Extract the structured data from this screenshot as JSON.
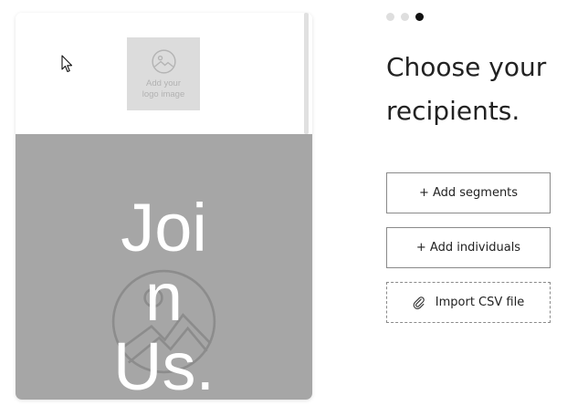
{
  "preview": {
    "logo_placeholder_line1": "Add your",
    "logo_placeholder_line2": "logo image",
    "hero_line1": "Joi",
    "hero_line2": "n",
    "hero_line3": "Us.",
    "background_color": "#a6a6a6"
  },
  "steps": {
    "total": 3,
    "current": 3
  },
  "title": {
    "line1": "Choose your",
    "line2": "recipients."
  },
  "buttons": {
    "add_segments": "+ Add segments",
    "add_individuals": "+ Add individuals",
    "import_csv": "Import CSV file"
  },
  "icons": {
    "logo_placeholder": "image-icon",
    "hero_placeholder": "image-icon",
    "import": "paperclip-icon",
    "cursor": "mouse-pointer"
  }
}
